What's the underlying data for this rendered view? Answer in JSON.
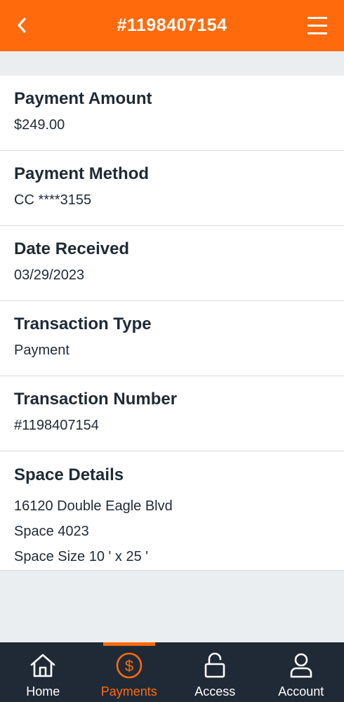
{
  "header": {
    "title": "#1198407154",
    "back_icon": "chevron-left-icon",
    "menu_icon": "hamburger-menu-icon"
  },
  "details": {
    "payment_amount": {
      "label": "Payment Amount",
      "value": "$249.00"
    },
    "payment_method": {
      "label": "Payment Method",
      "value": "CC ****3155"
    },
    "date_received": {
      "label": "Date Received",
      "value": "03/29/2023"
    },
    "transaction_type": {
      "label": "Transaction Type",
      "value": "Payment"
    },
    "transaction_number": {
      "label": "Transaction Number",
      "value": "#1198407154"
    },
    "space_details": {
      "label": "Space Details",
      "lines": [
        "16120 Double Eagle Blvd",
        "Space 4023",
        "Space Size 10 ' x 25 '"
      ]
    }
  },
  "nav": {
    "items": [
      {
        "label": "Home",
        "icon": "home-icon",
        "active": false
      },
      {
        "label": "Payments",
        "icon": "dollar-circle-icon",
        "active": true
      },
      {
        "label": "Access",
        "icon": "unlock-icon",
        "active": false
      },
      {
        "label": "Account",
        "icon": "user-icon",
        "active": false
      }
    ]
  },
  "colors": {
    "accent": "#ff6a0c",
    "nav_background": "#1f2a36",
    "page_background": "#ebeef0",
    "text": "#1f2a36"
  }
}
